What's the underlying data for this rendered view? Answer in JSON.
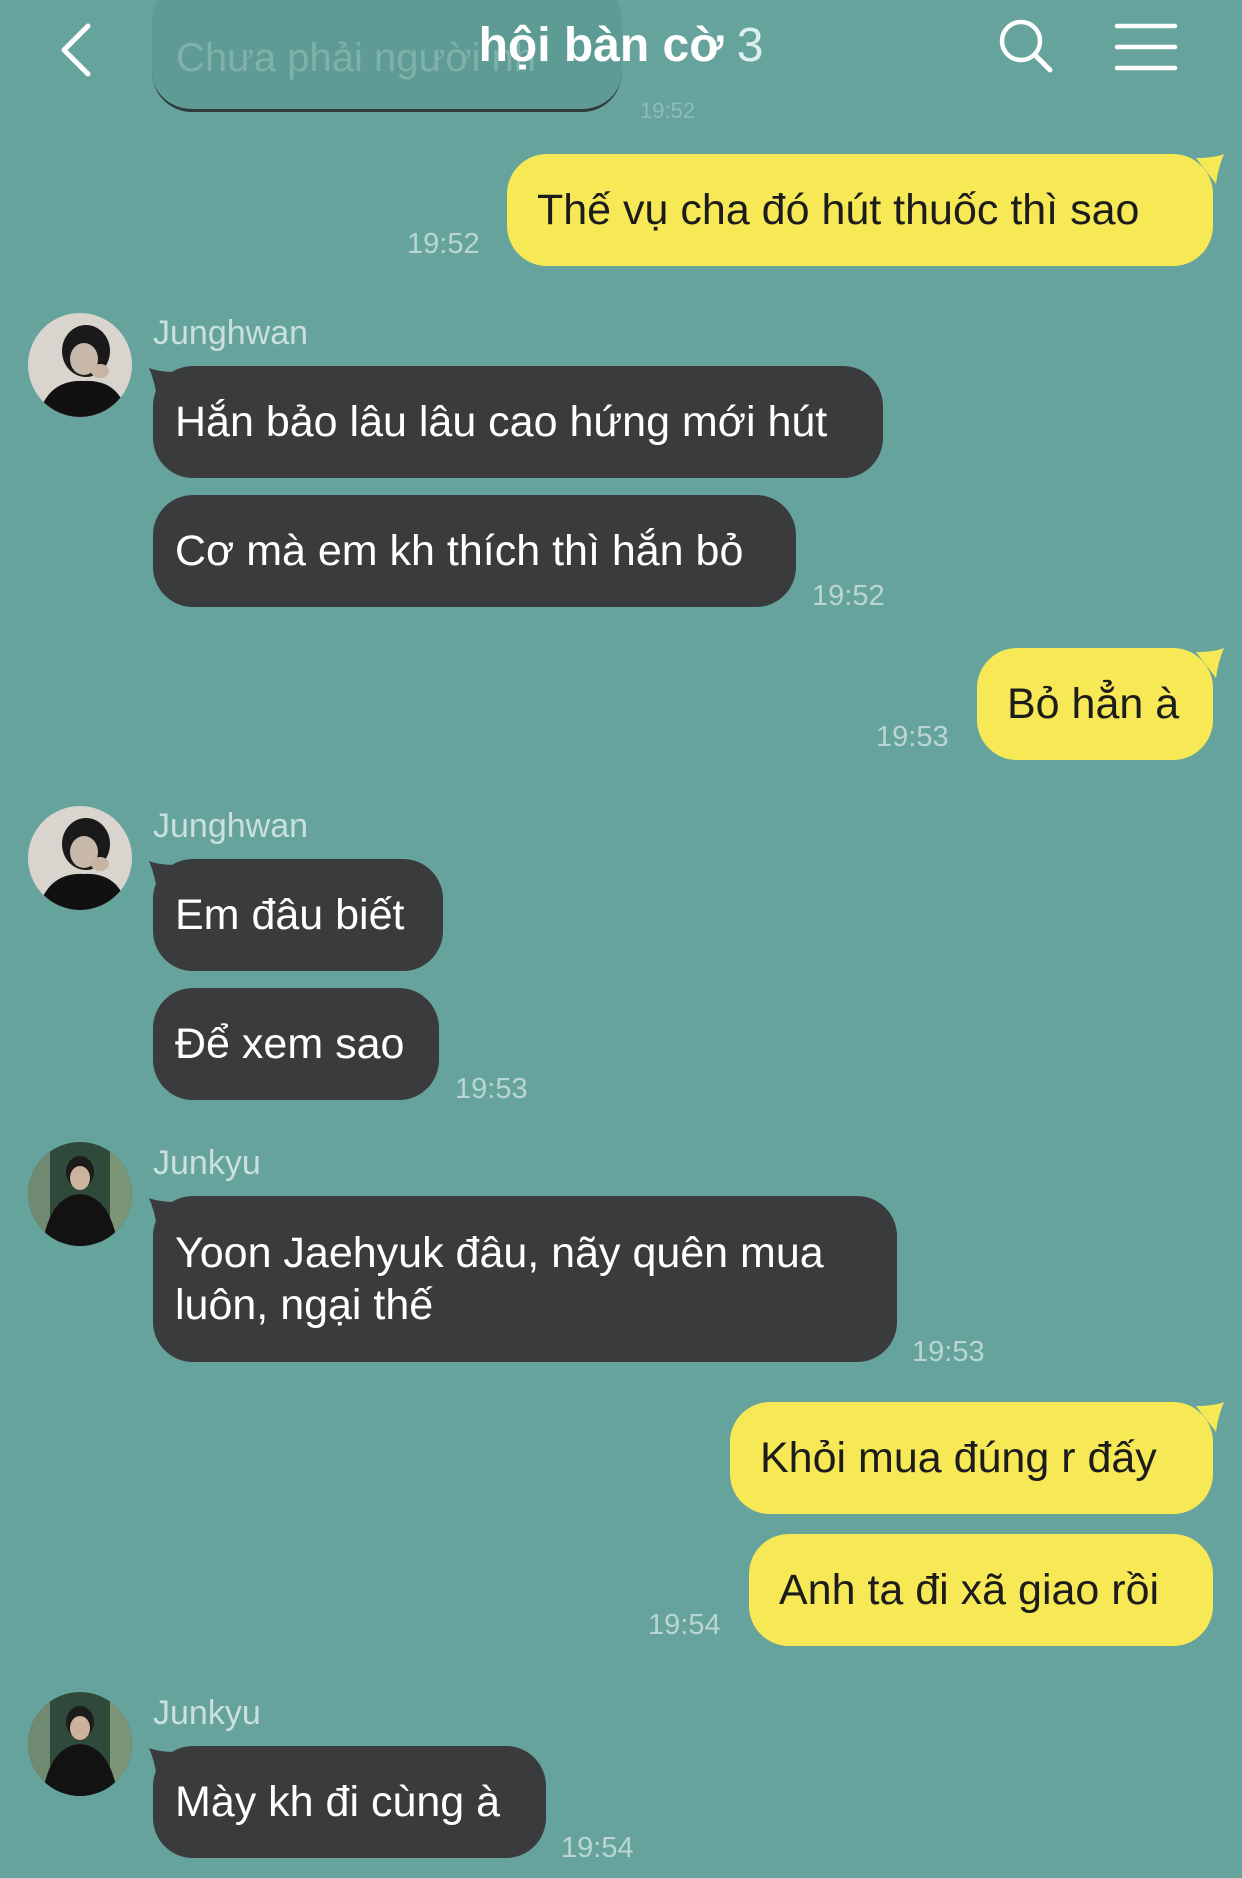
{
  "header": {
    "title": "hội bàn cờ",
    "count": "3",
    "ghost_message": "Chưa phải người nh",
    "ghost_time": "19:52"
  },
  "messages": {
    "m1": {
      "text": "Thế vụ cha đó hút thuốc thì sao",
      "time": "19:52"
    },
    "g1_sender": "Junghwan",
    "m2": {
      "text": "Hắn bảo lâu lâu cao hứng mới hút"
    },
    "m3": {
      "text": "Cơ mà em kh thích thì hắn bỏ",
      "time": "19:52"
    },
    "m4": {
      "text": "Bỏ hẳn à",
      "time": "19:53"
    },
    "g2_sender": "Junghwan",
    "m5": {
      "text": "Em đâu biết"
    },
    "m6": {
      "text": "Để xem sao",
      "time": "19:53"
    },
    "g3_sender": "Junkyu",
    "m7": {
      "line1": "Yoon Jaehyuk đâu, nãy quên mua",
      "line2": "luôn, ngại thế",
      "time": "19:53"
    },
    "m8": {
      "text": "Khỏi mua đúng r đấy"
    },
    "m9": {
      "text": "Anh ta đi xã giao rồi",
      "time": "19:54"
    },
    "g4_sender": "Junkyu",
    "m10": {
      "text": "Mày kh đi cùng à",
      "time": "19:54"
    }
  },
  "colors": {
    "background": "#66a39c",
    "outgoing_bubble": "#f7e855",
    "incoming_bubble": "#3a3b3d"
  }
}
